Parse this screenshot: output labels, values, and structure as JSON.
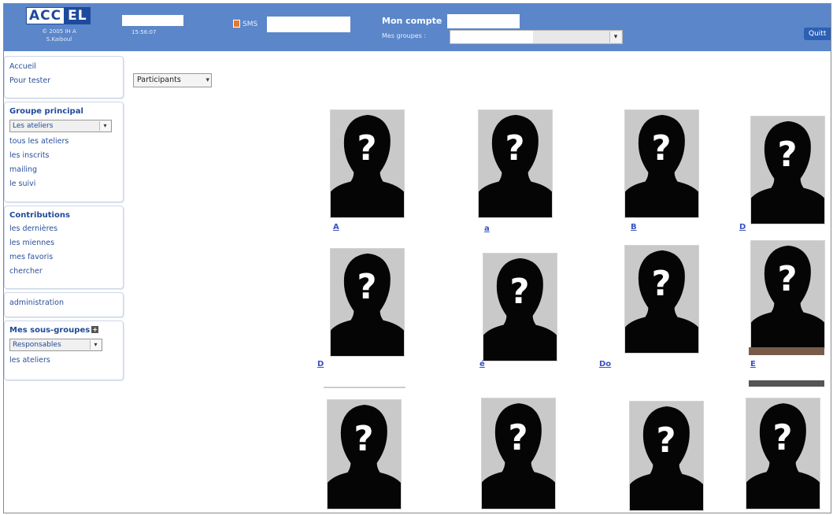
{
  "header": {
    "logo_left": "ACC",
    "logo_right": "EL",
    "logo_sub_line1": "© 2005 IH A",
    "logo_sub_line2": "S.Kaiboul",
    "clock": "15:56:07",
    "sms_label": "SMS",
    "account_label": "Mon compte",
    "groups_label": "Mes groupes :",
    "quit_label": "Quitt"
  },
  "sidebar": {
    "box1": [
      "Accueil",
      "Pour tester"
    ],
    "main_group_title": "Groupe principal",
    "main_group_select": "Les ateliers",
    "main_group_items": [
      "tous les ateliers",
      "les inscrits",
      "mailing",
      "le suivi"
    ],
    "contrib_title": "Contributions",
    "contrib_items": [
      "les dernières",
      "les miennes",
      "mes favoris",
      "chercher"
    ],
    "admin": "administration",
    "subgroups_title": "Mes sous-groupes",
    "subgroups_select": "Responsables",
    "subgroups_items": [
      "les ateliers"
    ]
  },
  "main": {
    "view_select": "Participants",
    "photo_glyph": "?",
    "labels": [
      "A",
      "a",
      "B",
      "D",
      "D",
      "é",
      "Do",
      "E"
    ],
    "colors": {
      "header": "#5b86c9",
      "link": "#3a53c2",
      "photo_bg": "#c9c9c9",
      "silhouette": "#050505"
    }
  }
}
